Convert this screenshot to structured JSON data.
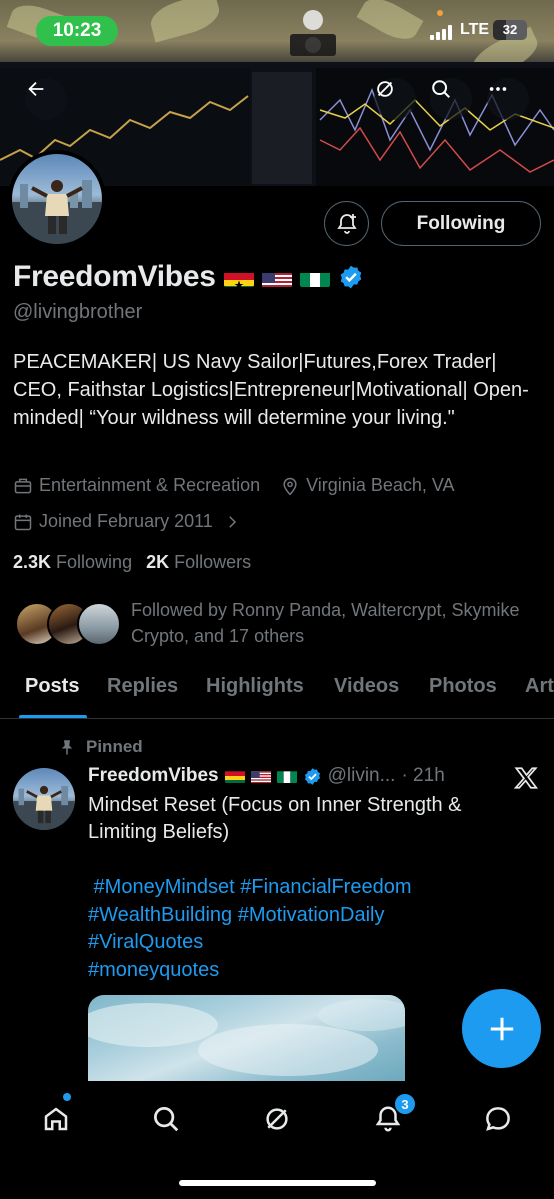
{
  "status_bar": {
    "time": "10:23",
    "network": "LTE",
    "battery": "32"
  },
  "profile": {
    "display_name": "FreedomVibes",
    "handle": "@livingbrother",
    "bio": "PEACEMAKER| US Navy Sailor|Futures,Forex Trader| CEO, Faithstar Logistics|Entrepreneur|Motivational| Open-minded| “Your wildness will determine your living.\"",
    "category": "Entertainment & Recreation",
    "location": "Virginia Beach, VA",
    "joined": "Joined February 2011",
    "following_count": "2.3K",
    "following_label": "Following",
    "followers_count": "2K",
    "followers_label": "Followers",
    "followed_by": "Followed by Ronny Panda, Waltercrypt, Skymike Crypto, and 17 others",
    "following_button": "Following"
  },
  "tabs": [
    "Posts",
    "Replies",
    "Highlights",
    "Videos",
    "Photos",
    "Art"
  ],
  "post": {
    "pinned_label": "Pinned",
    "author": "FreedomVibes",
    "handle": "@livin...",
    "time": "· 21h",
    "text": "Mindset Reset (Focus on Inner Strength & Limiting Beliefs)",
    "tags": [
      " #MoneyMindset #FinancialFreedom",
      "#WealthBuilding #MotivationDaily",
      "#ViralQuotes",
      "#moneyquotes"
    ]
  },
  "notifications_badge": "3",
  "colors": {
    "accent": "#1d9bf0",
    "muted": "#71767b",
    "text": "#e7e9ea",
    "background": "#000000",
    "status_time_pill": "#30c04b"
  },
  "icons": [
    "back-arrow-icon",
    "grok-icon",
    "search-icon",
    "more-icon",
    "bell-plus-icon",
    "verified-badge-icon",
    "briefcase-icon",
    "location-pin-icon",
    "calendar-icon",
    "chevron-right-icon",
    "pin-icon",
    "x-logo-icon",
    "plus-icon",
    "home-icon",
    "search-icon",
    "grok-icon",
    "bell-icon",
    "messages-icon"
  ]
}
